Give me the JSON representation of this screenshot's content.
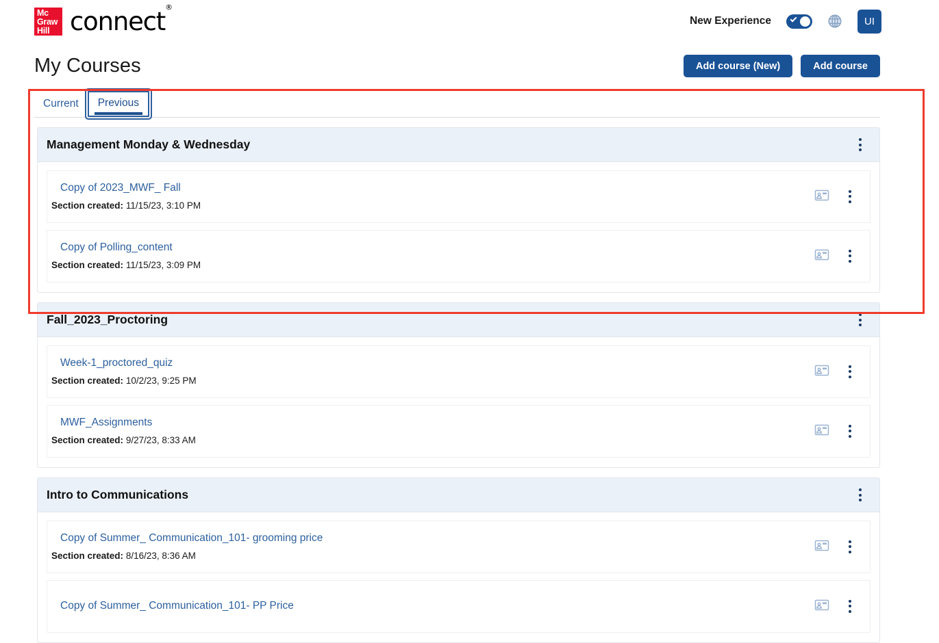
{
  "header": {
    "logo_mc": "Mc",
    "logo_graw": "Graw",
    "logo_hill": "Hill",
    "product_name": "connect",
    "new_experience_label": "New Experience",
    "toggle_state": "on",
    "globe_icon": "globe-icon",
    "avatar_initials": "UI",
    "accent_blue": "#1a5296",
    "brand_red": "#e8112d"
  },
  "page": {
    "title": "My Courses",
    "add_course_new_label": "Add course (New)",
    "add_course_label": "Add course"
  },
  "tabs": [
    {
      "label": "Current",
      "selected": false
    },
    {
      "label": "Previous",
      "selected": true
    }
  ],
  "courses": [
    {
      "title": "Management Monday & Wednesday",
      "menu_icon": "kebab-menu-icon",
      "sections": [
        {
          "name": "Copy of 2023_MWF_ Fall",
          "meta_label": "Section created:",
          "meta_value": "11/15/23, 3:10 PM",
          "presentation_icon": "presentation-icon",
          "menu_icon": "kebab-menu-icon"
        },
        {
          "name": "Copy of Polling_content",
          "meta_label": "Section created:",
          "meta_value": "11/15/23, 3:09 PM",
          "presentation_icon": "presentation-icon",
          "menu_icon": "kebab-menu-icon"
        }
      ]
    },
    {
      "title": "Fall_2023_Proctoring",
      "menu_icon": "kebab-menu-icon",
      "sections": [
        {
          "name": "Week-1_proctored_quiz",
          "meta_label": "Section created:",
          "meta_value": "10/2/23, 9:25 PM",
          "presentation_icon": "presentation-icon",
          "menu_icon": "kebab-menu-icon"
        },
        {
          "name": "MWF_Assignments",
          "meta_label": "Section created:",
          "meta_value": "9/27/23, 8:33 AM",
          "presentation_icon": "presentation-icon",
          "menu_icon": "kebab-menu-icon"
        }
      ]
    },
    {
      "title": "Intro to Communications",
      "menu_icon": "kebab-menu-icon",
      "sections": [
        {
          "name": "Copy of Summer_ Communication_101- grooming price",
          "meta_label": "Section created:",
          "meta_value": "8/16/23, 8:36 AM",
          "presentation_icon": "presentation-icon",
          "menu_icon": "kebab-menu-icon"
        },
        {
          "name": "Copy of Summer_ Communication_101- PP Price",
          "meta_label": "",
          "meta_value": "",
          "presentation_icon": "presentation-icon",
          "menu_icon": "kebab-menu-icon"
        }
      ]
    }
  ],
  "annotation": {
    "color": "#ef3b2d",
    "shape": "rectangle"
  }
}
